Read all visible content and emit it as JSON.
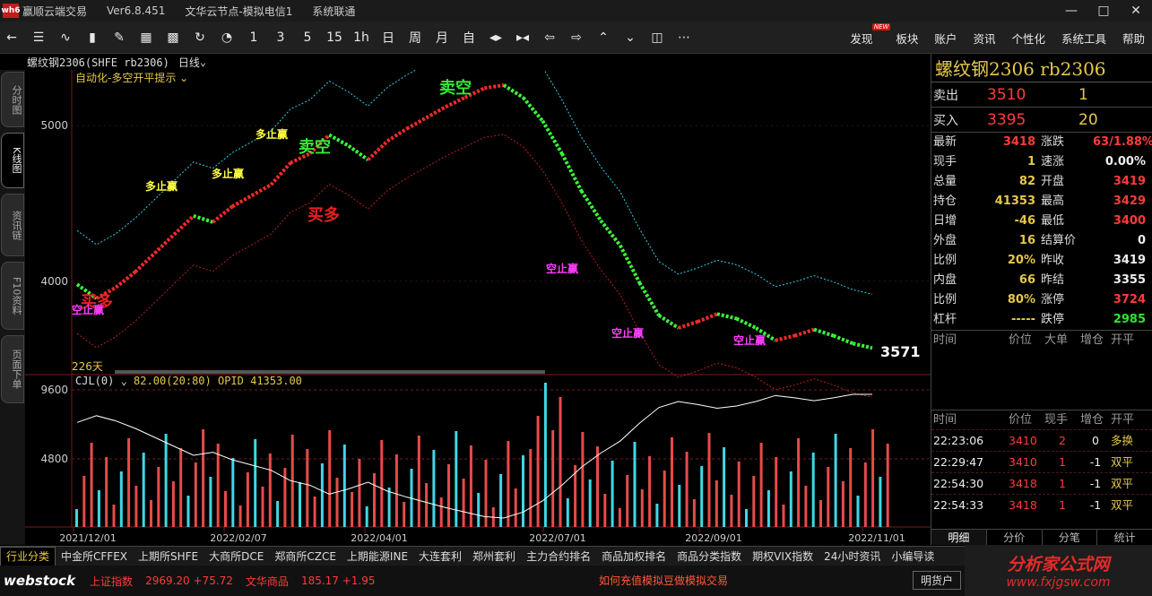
{
  "window": {
    "app_title": "赢顺云端交易",
    "version": "Ver6.8.451",
    "server": "文华云节点-模拟电信1",
    "status": "系统联通",
    "logo_text": "wh6"
  },
  "toolbar": {
    "periods": [
      "1",
      "3",
      "5",
      "15",
      "1h",
      "日",
      "周",
      "月",
      "自"
    ],
    "menu": [
      "发现",
      "板块",
      "账户",
      "资讯",
      "个性化",
      "系统工具",
      "帮助"
    ],
    "new_badge": "NEW"
  },
  "left_tabs": [
    "分时图",
    "K线图",
    "资讯链",
    "F10资料",
    "页面下单"
  ],
  "chart_header": {
    "symbol": "螺纹钢2306(SHFE rb2306)",
    "period": "日线",
    "indicator": "自动化-多空开平提示",
    "days": "226天",
    "last_price_label": "3571"
  },
  "chart_labels": {
    "sell_open": "卖空",
    "buy_long": "买多",
    "long_stop": "多止赢",
    "short_stop": "空止赢"
  },
  "sub_chart": {
    "name": "CJL(0)",
    "values": "82.00(20:80)  OPID 41353.00"
  },
  "chart_data": {
    "type": "line",
    "title": "螺纹钢2306(SHFE rb2306)",
    "x_ticks": [
      "2021/12/01",
      "2022/02/07",
      "2022/04/01",
      "2022/07/01",
      "2022/09/01",
      "2022/11/01"
    ],
    "price_axis_ticks": [
      5000,
      4000
    ],
    "volume_axis_ticks": [
      9600,
      4800
    ],
    "price_series": [
      3980,
      3890,
      3960,
      4060,
      4180,
      4300,
      4420,
      4380,
      4480,
      4550,
      4620,
      4760,
      4820,
      4940,
      4870,
      4780,
      4900,
      4980,
      5050,
      5120,
      5180,
      5240,
      5260,
      5180,
      5030,
      4820,
      4580,
      4390,
      4230,
      3990,
      3780,
      3700,
      3740,
      3790,
      3760,
      3700,
      3620,
      3650,
      3690,
      3650,
      3600,
      3571
    ]
  },
  "quote": {
    "name": "螺纹钢2306  rb2306",
    "ask_label": "卖出",
    "ask_price": "3510",
    "ask_vol": "1",
    "bid_label": "买入",
    "bid_price": "3395",
    "bid_vol": "20",
    "fields": [
      {
        "k": "最新",
        "v": "3418",
        "c": "red",
        "k2": "涨跌",
        "v2": "63/1.88%",
        "c2": "red"
      },
      {
        "k": "现手",
        "v": "1",
        "c": "yel",
        "k2": "速涨",
        "v2": "0.00%",
        "c2": "wht"
      },
      {
        "k": "总量",
        "v": "82",
        "c": "yel",
        "k2": "开盘",
        "v2": "3419",
        "c2": "red"
      },
      {
        "k": "持仓",
        "v": "41353",
        "c": "yel",
        "k2": "最高",
        "v2": "3429",
        "c2": "red"
      },
      {
        "k": "日增",
        "v": "-46",
        "c": "yel",
        "k2": "最低",
        "v2": "3400",
        "c2": "red"
      },
      {
        "k": "外盘",
        "v": "16",
        "c": "yel",
        "k2": "结算价",
        "v2": "0",
        "c2": "wht"
      },
      {
        "k": "比例",
        "v": "20%",
        "c": "yel",
        "k2": "昨收",
        "v2": "3419",
        "c2": "wht"
      },
      {
        "k": "内盘",
        "v": "66",
        "c": "yel",
        "k2": "昨结",
        "v2": "3355",
        "c2": "wht"
      },
      {
        "k": "比例",
        "v": "80%",
        "c": "yel",
        "k2": "涨停",
        "v2": "3724",
        "c2": "red"
      },
      {
        "k": "杠杆",
        "v": "-----",
        "c": "yel",
        "k2": "跌停",
        "v2": "2985",
        "c2": "grn"
      }
    ],
    "table_headers": [
      "时间",
      "价位",
      "大单",
      "增仓",
      "开平"
    ],
    "tick_headers": [
      "时间",
      "价位",
      "现手",
      "增仓",
      "开平"
    ],
    "ticks": [
      {
        "t": "22:23:06",
        "p": "3410",
        "v": "2",
        "z": "0",
        "o": "多换"
      },
      {
        "t": "22:29:47",
        "p": "3410",
        "v": "1",
        "z": "-1",
        "o": "双平"
      },
      {
        "t": "22:54:30",
        "p": "3418",
        "v": "1",
        "z": "-1",
        "o": "双平"
      },
      {
        "t": "22:54:33",
        "p": "3418",
        "v": "1",
        "z": "-1",
        "o": "双平"
      }
    ],
    "tabs": [
      "明细",
      "分价",
      "分笔",
      "统计"
    ]
  },
  "bottom_tabs": [
    "行业分类",
    "中金所CFFEX",
    "上期所SHFE",
    "大商所DCE",
    "郑商所CZCE",
    "上期能源INE",
    "大连套利",
    "郑州套利",
    "主力合约排名",
    "商品加权排名",
    "商品分类指数",
    "期权VIX指数",
    "24小时资讯",
    "小编导读"
  ],
  "status": {
    "logo": "webstock",
    "idx1_name": "上证指数",
    "idx1_val": "2969.20  +75.72",
    "idx2_name": "文华商品",
    "idx2_val": "185.17  +1.95",
    "notice": "如何充值模拟豆做模拟交易",
    "btn": "明货户"
  },
  "brand": {
    "line1": "分析家公式网",
    "line2": "www.fxjgsw.com"
  }
}
